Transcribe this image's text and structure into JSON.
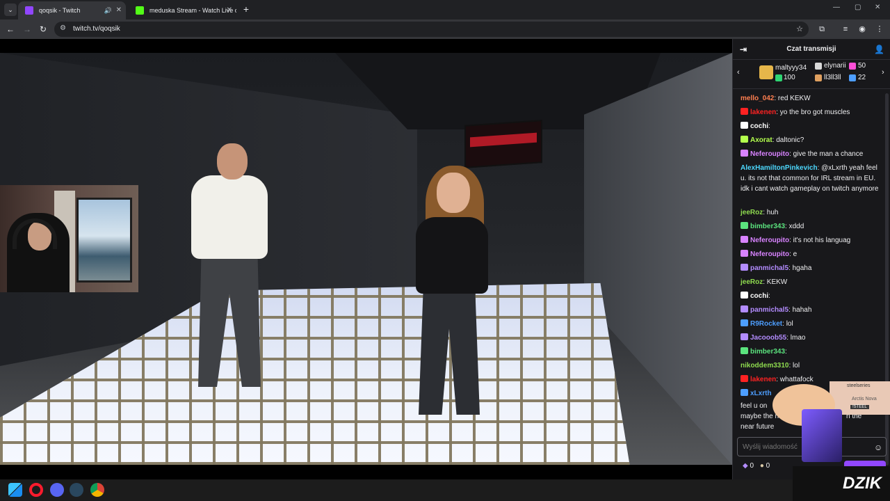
{
  "browser": {
    "tabs": [
      {
        "title": "qoqsik - Twitch",
        "favicon": "twitch-icon",
        "active": true
      },
      {
        "title": "meduska Stream - Watch Live o",
        "favicon": "kick-icon",
        "active": false
      }
    ],
    "url": "twitch.tv/qoqsik"
  },
  "chat": {
    "header": "Czat transmisji",
    "leaderboard": {
      "top": {
        "name": "maltyyy34",
        "score": "100"
      },
      "others": [
        {
          "name": "elynarii",
          "score": "50"
        },
        {
          "name": "ll3ll3ll",
          "score": "22"
        }
      ]
    },
    "messages": [
      {
        "user": "mello_042",
        "color": "#ff7f50",
        "text": ": red KEKW",
        "badge": false
      },
      {
        "user": "lakenen",
        "color": "#ff2222",
        "text": ": yo the bro got muscles",
        "badge": true
      },
      {
        "user": "cochi",
        "color": "#ffffff",
        "text": ":",
        "badge": true
      },
      {
        "user": "Axorat",
        "color": "#b3ff4d",
        "text": ": daltonic?",
        "badge": true
      },
      {
        "user": "Neferoupito",
        "color": "#d883ff",
        "text": ": give the man a chance",
        "badge": true
      },
      {
        "user": "AlexHamiltonPinkevich",
        "color": "#4dd9ff",
        "text": ": @xLxrth yeah feel u. its not that common for IRL stream in EU. idk i cant watch gameplay on twitch anymore",
        "badge": false
      },
      {
        "user": "jeeRoz",
        "color": "#8fdb4f",
        "text": ": huh",
        "badge": false
      },
      {
        "user": "bimber343",
        "color": "#5be37e",
        "text": ": xddd",
        "badge": true
      },
      {
        "user": "Neferoupito",
        "color": "#d883ff",
        "text": ": it's not his languag",
        "badge": true
      },
      {
        "user": "Neferoupito",
        "color": "#d883ff",
        "text": ": e",
        "badge": true
      },
      {
        "user": "panmichal5",
        "color": "#b38cff",
        "text": ": hgaha",
        "badge": true
      },
      {
        "user": "jeeRoz",
        "color": "#8fdb4f",
        "text": ": KEKW",
        "badge": false
      },
      {
        "user": "cochi",
        "color": "#ffffff",
        "text": ":",
        "badge": true
      },
      {
        "user": "panmichal5",
        "color": "#b38cff",
        "text": ": hahah",
        "badge": true
      },
      {
        "user": "R9Rocket",
        "color": "#4d9eff",
        "text": ": lol",
        "badge": true
      },
      {
        "user": "Jacooob55",
        "color": "#b38cff",
        "text": ": lmao",
        "badge": true
      },
      {
        "user": "bimber343",
        "color": "#5be37e",
        "text": ":",
        "badge": true
      },
      {
        "user": "nikoddem3310",
        "color": "#8fdb4f",
        "text": ": lol",
        "badge": false
      },
      {
        "user": "lakenen",
        "color": "#ff2222",
        "text": ": whattafock",
        "badge": true
      },
      {
        "user": "xLxrth",
        "color": "#4d9eff",
        "text": "",
        "badge": true
      }
    ],
    "partial_lines": [
      "feel u on",
      "maybe the new jam",
      "n the",
      "near future"
    ],
    "input_placeholder": "Wyślij wiadomość",
    "points_a": "0",
    "points_b": "0"
  },
  "ad": {
    "brand": "steelseries",
    "tag": "Arctis Nova",
    "label": "!STEEL"
  },
  "watermark": "DZIK",
  "taskbar": {
    "apps": [
      "windows-start-icon",
      "opera-gx-icon",
      "discord-icon",
      "steam-icon",
      "chrome-icon"
    ]
  }
}
